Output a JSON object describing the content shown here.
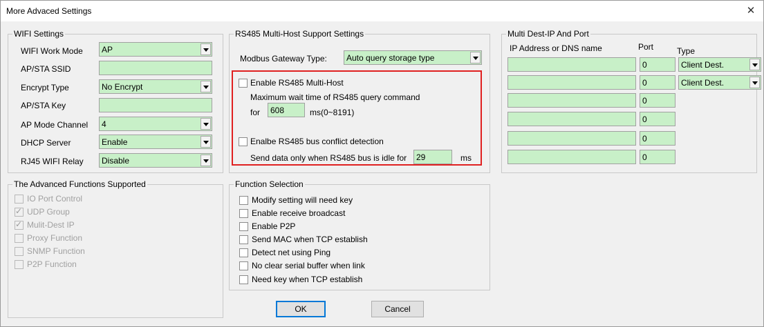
{
  "window": {
    "title": "More Advaced Settings",
    "close_glyph": "✕"
  },
  "wifi": {
    "title": "WIFI Settings",
    "work_mode_label": "WIFI Work Mode",
    "work_mode_value": "AP",
    "ssid_label": "AP/STA SSID",
    "ssid_value": "",
    "encrypt_label": "Encrypt Type",
    "encrypt_value": "No Encrypt",
    "key_label": "AP/STA Key",
    "key_value": "",
    "channel_label": "AP Mode Channel",
    "channel_value": "4",
    "dhcp_label": "DHCP Server",
    "dhcp_value": "Enable",
    "relay_label": "RJ45 WIFI Relay",
    "relay_value": "Disable"
  },
  "rs485": {
    "title": "RS485 Multi-Host Support Settings",
    "gateway_label": "Modbus Gateway Type:",
    "gateway_value": "Auto query storage type",
    "multihost_label": "Enable RS485 Multi-Host",
    "wait_text": "Maximum wait time of RS485  query command",
    "for_label": "for",
    "wait_value": "608",
    "wait_unit": "ms(0~8191)",
    "conflict_label": "Enalbe RS485 bus conflict detection",
    "idle_text": "Send data only when RS485 bus is idle for",
    "idle_value": "29",
    "idle_unit": "ms"
  },
  "multidest": {
    "title": "Multi Dest-IP And Port",
    "col_ip": "IP Address or DNS name",
    "col_port": "Port",
    "col_type": "Type",
    "rows": [
      {
        "ip": "",
        "port": "0",
        "type": "Client Dest."
      },
      {
        "ip": "",
        "port": "0",
        "type": "Client Dest."
      },
      {
        "ip": "",
        "port": "0"
      },
      {
        "ip": "",
        "port": "0"
      },
      {
        "ip": "",
        "port": "0"
      },
      {
        "ip": "",
        "port": "0"
      }
    ]
  },
  "advanced": {
    "title": "The Advanced Functions Supported",
    "items": [
      {
        "label": "IO Port Control",
        "checked": false
      },
      {
        "label": "UDP Group",
        "checked": true
      },
      {
        "label": "Mulit-Dest IP",
        "checked": true
      },
      {
        "label": "Proxy Function",
        "checked": false
      },
      {
        "label": "SNMP Function",
        "checked": false
      },
      {
        "label": "P2P Function",
        "checked": false
      }
    ]
  },
  "functions": {
    "title": "Function Selection",
    "items": [
      {
        "label": "Modify setting will need key"
      },
      {
        "label": "Enable receive broadcast"
      },
      {
        "label": "Enable P2P"
      },
      {
        "label": "Send MAC when TCP establish"
      },
      {
        "label": "Detect net using Ping"
      },
      {
        "label": "No clear serial buffer when link"
      },
      {
        "label": "Need key when TCP establish"
      }
    ]
  },
  "buttons": {
    "ok": "OK",
    "cancel": "Cancel"
  },
  "colors": {
    "field_bg": "#c8f0c8",
    "highlight": "#e02020",
    "window_bg": "#f0f0f0"
  }
}
